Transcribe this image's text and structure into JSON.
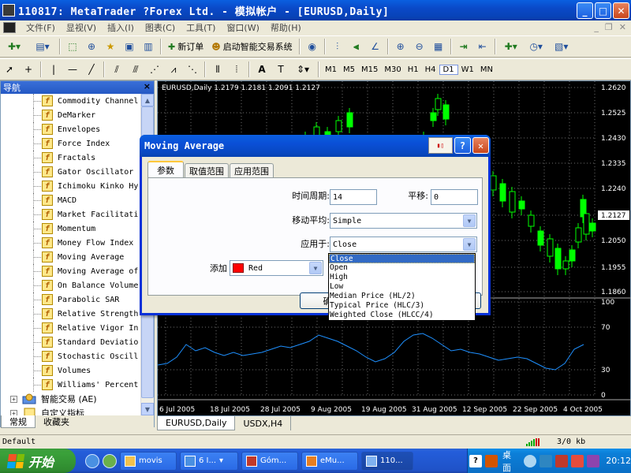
{
  "window": {
    "title": "110817: MetaTrader ?Forex Ltd. - 模拟帐户 - [EURUSD,Daily]",
    "min": "_",
    "max": "□",
    "close": "✕"
  },
  "menu": {
    "items": [
      "文件(F)",
      "显视(V)",
      "插入(I)",
      "图表(C)",
      "工具(T)",
      "窗口(W)",
      "帮助(H)"
    ],
    "mdi_min": "_",
    "mdi_restore": "❐",
    "mdi_close": "✕"
  },
  "toolbar": {
    "new_order": "新订单",
    "auto_trading": "启动智能交易系统",
    "text_tool": "A",
    "timeframes": [
      "M1",
      "M5",
      "M15",
      "M30",
      "H1",
      "H4",
      "D1",
      "W1",
      "MN"
    ],
    "active_timeframe": "D1"
  },
  "navigator": {
    "title": "导航",
    "close": "×",
    "indicator_glyph": "f",
    "items": [
      "Commodity Channel",
      "DeMarker",
      "Envelopes",
      "Force Index",
      "Fractals",
      "Gator Oscillator",
      "Ichimoku Kinko Hy",
      "MACD",
      "Market Facilitati",
      "Momentum",
      "Money Flow Index",
      "Moving Average",
      "Moving Average of",
      "On Balance Volume",
      "Parabolic SAR",
      "Relative Strength",
      "Relative Vigor In",
      "Standard Deviatio",
      "Stochastic Oscill",
      "Volumes",
      "Williams' Percent"
    ],
    "groups": [
      "智能交易 (AE)",
      "自定义指标"
    ],
    "tabs": [
      "常规",
      "收藏夹"
    ]
  },
  "chart": {
    "symbol_header": "EURUSD,Daily  1.2179 1.2181 1.2091 1.2127",
    "price_labels": [
      "1.2620",
      "1.2525",
      "1.2430",
      "1.2335",
      "1.2240",
      "1.2127",
      "1.2050",
      "1.1955",
      "1.1860"
    ],
    "current_price": "1.2127",
    "osc_labels": [
      "100",
      "70",
      "30",
      "0"
    ],
    "date_labels": [
      "6 Jul 2005",
      "18 Jul 2005",
      "28 Jul 2005",
      "9 Aug 2005",
      "19 Aug 2005",
      "31 Aug 2005",
      "12 Sep 2005",
      "22 Sep 2005",
      "4 Oct 2005"
    ],
    "tabs": [
      "EURUSD,Daily",
      "USDX,H4"
    ],
    "colors": {
      "background": "#000000",
      "bull": "#00ff00",
      "bear": "#00ff00",
      "oscillator": "#1e90ff",
      "grid": "#6e6e6e"
    }
  },
  "dialog": {
    "title": "Moving Average",
    "help": "?",
    "close": "✕",
    "tabs": [
      "参数",
      "取值范围",
      "应用范围"
    ],
    "period_label": "时间周期:",
    "period_value": "14",
    "shift_label": "平移:",
    "shift_value": "0",
    "method_label": "移动平均:",
    "method_value": "Simple",
    "apply_label": "应用于:",
    "apply_value": "Close",
    "color_label": "添加",
    "color_value": "Red",
    "color_hex": "#ff0000",
    "ok_label": "确"
  },
  "dropdown": {
    "options": [
      "Close",
      "Open",
      "High",
      "Low",
      "Median Price (HL/2)",
      "Typical Price (HLC/3)",
      "Weighted Close (HLCC/4)"
    ],
    "selected": "Close"
  },
  "status": {
    "profile": "Default",
    "traffic": "3/0 kb"
  },
  "taskbar": {
    "start": "开始",
    "tasks": [
      "movis",
      "6 I...",
      "Góm...",
      "eMu...",
      "110..."
    ],
    "ime": "桌面",
    "clock": "20:12"
  }
}
